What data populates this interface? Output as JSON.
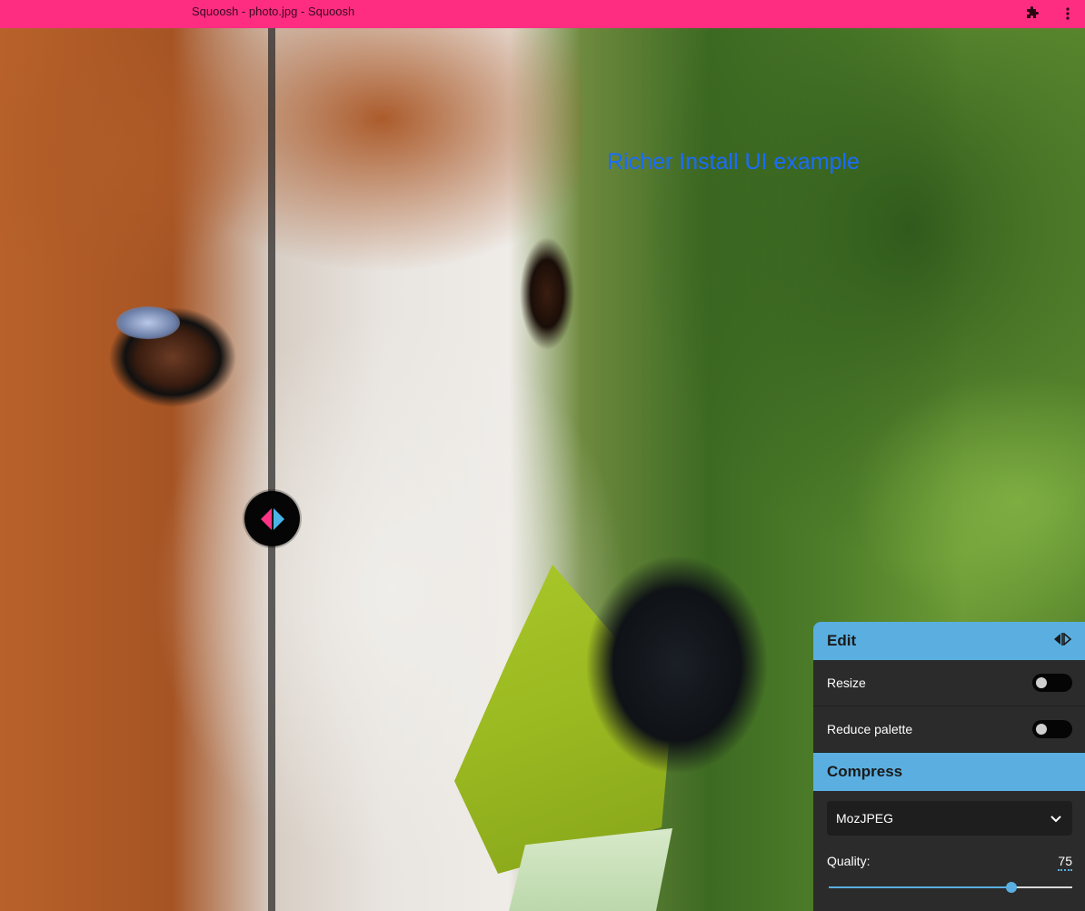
{
  "window": {
    "title": "Squoosh - photo.jpg - Squoosh",
    "accent_color": "#ff2d82",
    "extensions_icon": "puzzle-icon",
    "menu_icon": "kebab-menu-icon"
  },
  "canvas": {
    "overlay_text": "Richer Install UI example",
    "overlay_color": "#1a6cff",
    "split_handle_icon": "split-view-handle-icon"
  },
  "panel": {
    "accent_color": "#5aafe0",
    "edit": {
      "title": "Edit",
      "toggle_icon": "split-arrows-icon",
      "options": [
        {
          "label": "Resize",
          "enabled": false
        },
        {
          "label": "Reduce palette",
          "enabled": false
        }
      ]
    },
    "compress": {
      "title": "Compress",
      "codec": "MozJPEG",
      "quality_label": "Quality:",
      "quality_value": "75",
      "quality_level": 0.75
    }
  }
}
